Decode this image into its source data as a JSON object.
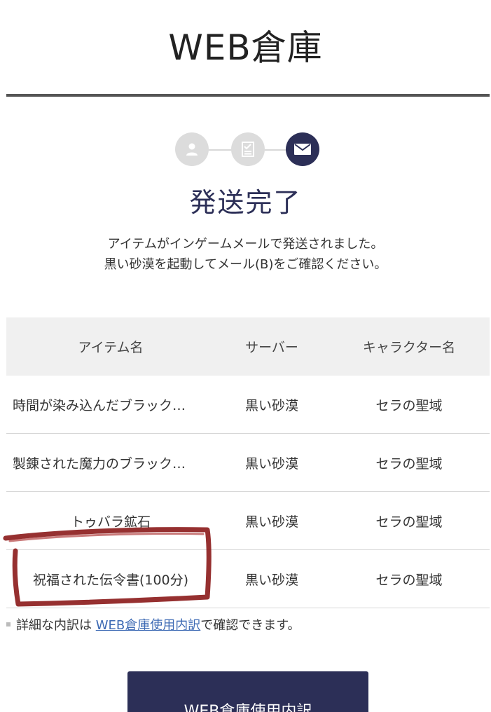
{
  "header": {
    "title": "WEB倉庫"
  },
  "progress": {
    "steps": [
      {
        "icon": "user-icon",
        "state": "done"
      },
      {
        "icon": "checklist-icon",
        "state": "done"
      },
      {
        "icon": "mail-icon",
        "state": "current"
      }
    ]
  },
  "status": {
    "title": "発送完了",
    "message_line1": "アイテムがインゲームメールで発送されました。",
    "message_line2": "黒い砂漠を起動してメール(B)をご確認ください。"
  },
  "table": {
    "headers": [
      "アイテム名",
      "サーバー",
      "キャラクター名"
    ],
    "rows": [
      [
        "時間が染み込んだブラック…",
        "黒い砂漠",
        "セラの聖域"
      ],
      [
        "製錬された魔力のブラック…",
        "黒い砂漠",
        "セラの聖域"
      ],
      [
        "トゥバラ鉱石",
        "黒い砂漠",
        "セラの聖域"
      ],
      [
        "祝福された伝令書(100分)",
        "黒い砂漠",
        "セラの聖域"
      ]
    ]
  },
  "note": {
    "prefix": "詳細な内訳は ",
    "link": "WEB倉庫使用内訳",
    "suffix": "で確認できます。"
  },
  "button": {
    "label": "WEB倉庫使用内訳"
  },
  "colors": {
    "accent": "#2c2f57",
    "link": "#3d6ab4",
    "annotation": "#8b1a1a"
  }
}
